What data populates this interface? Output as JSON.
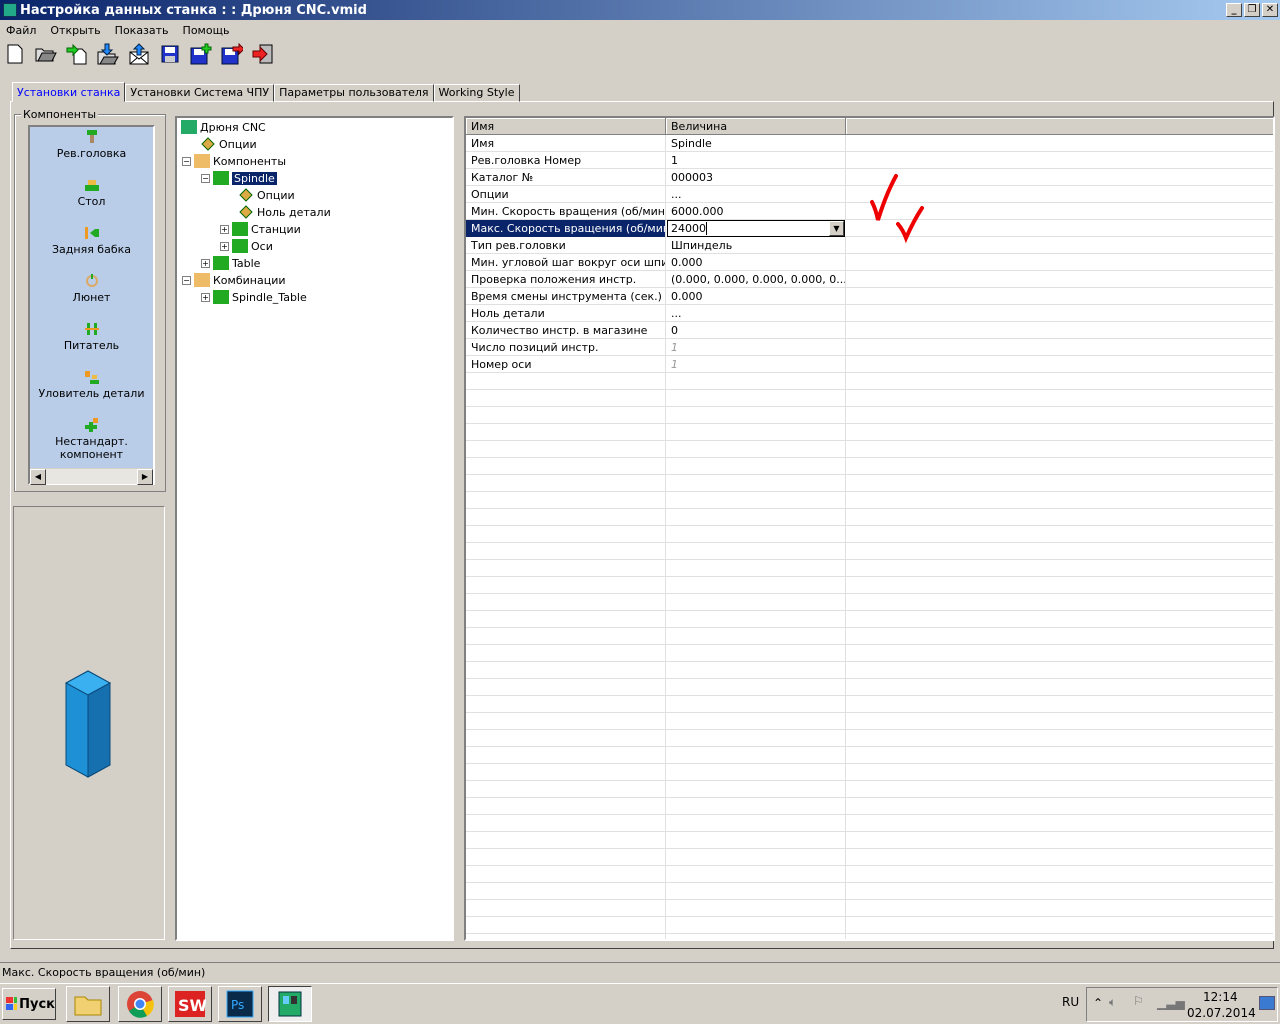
{
  "window": {
    "title": "Настройка данных станка : : Дрюня CNC.vmid",
    "minimize": "_",
    "restore": "❐",
    "close": "✕"
  },
  "menu": [
    "Файл",
    "Открыть",
    "Показать",
    "Помощь"
  ],
  "toolbar": [
    "new-icon",
    "open-icon",
    "import-icon",
    "load-icon",
    "export-mail-icon",
    "save-icon",
    "save-add-icon",
    "save-as-icon",
    "exit-icon"
  ],
  "tabs": [
    "Установки станка",
    "Установки Система ЧПУ",
    "Параметры пользователя",
    "Working Style"
  ],
  "components": {
    "label": "Компоненты",
    "items": [
      "Рев.головка",
      "Стол",
      "Задняя бабка",
      "Люнет",
      "Питатель",
      "Уловитель детали",
      "Нестандарт. компонент"
    ]
  },
  "tree": [
    {
      "label": "Дрюня CNC",
      "level": 0,
      "exp": ""
    },
    {
      "label": "Опции",
      "level": 1,
      "exp": ""
    },
    {
      "label": "Компоненты",
      "level": 1,
      "exp": "−"
    },
    {
      "label": "Spindle",
      "level": 2,
      "exp": "−",
      "selected": true
    },
    {
      "label": "Опции",
      "level": 3,
      "exp": ""
    },
    {
      "label": "Ноль детали",
      "level": 3,
      "exp": ""
    },
    {
      "label": "Станции",
      "level": 3,
      "exp": "+"
    },
    {
      "label": "Оси",
      "level": 3,
      "exp": "+"
    },
    {
      "label": "Table",
      "level": 2,
      "exp": "+"
    },
    {
      "label": "Комбинации",
      "level": 1,
      "exp": "−"
    },
    {
      "label": "Spindle_Table",
      "level": 2,
      "exp": "+"
    }
  ],
  "grid": {
    "headers": [
      "Имя",
      "Величина"
    ],
    "rows": [
      [
        "Имя",
        "Spindle"
      ],
      [
        "Рев.головка Номер",
        "1"
      ],
      [
        "Каталог №",
        "000003"
      ],
      [
        "Опции",
        "..."
      ],
      [
        "Мин. Скорость вращения (об/мин)",
        "6000.000"
      ],
      [
        "Макс. Скорость вращения (об/мин)",
        "24000"
      ],
      [
        "Тип рев.головки",
        "Шпиндель"
      ],
      [
        "Мин. угловой шаг вокруг оси шпин...",
        "0.000"
      ],
      [
        "Проверка положения инстр.",
        "(0.000, 0.000, 0.000, 0.000, 0...."
      ],
      [
        "Время смены инструмента (сек.)",
        "0.000"
      ],
      [
        "Ноль детали",
        "..."
      ],
      [
        "Количество инстр. в магазине",
        "0"
      ],
      [
        "Число позиций инстр.",
        "1"
      ],
      [
        "Номер оси",
        "1"
      ]
    ],
    "editing_row": 5
  },
  "status": "Макс. Скорость вращения (об/мин)",
  "taskbar": {
    "start": "Пуск",
    "lang": "RU",
    "time": "12:14",
    "date": "02.07.2014",
    "apps": [
      "explorer",
      "chrome",
      "solidworks",
      "photoshop",
      "machine-setup"
    ]
  }
}
